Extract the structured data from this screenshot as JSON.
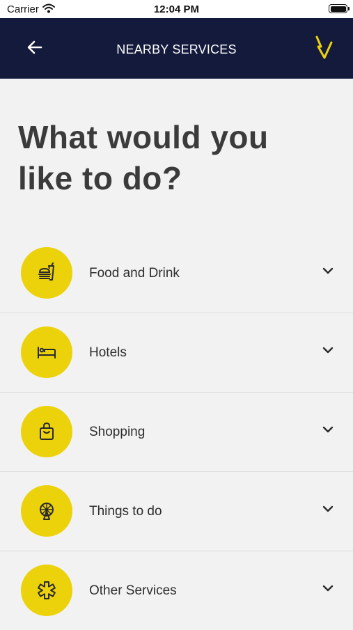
{
  "status": {
    "carrier": "Carrier",
    "time": "12:04 PM"
  },
  "nav": {
    "title": "NEARBY SERVICES"
  },
  "heading": "What would you like to do?",
  "categories": [
    {
      "label": "Food and Drink",
      "icon": "food-icon"
    },
    {
      "label": "Hotels",
      "icon": "bed-icon"
    },
    {
      "label": "Shopping",
      "icon": "bag-icon"
    },
    {
      "label": "Things to do",
      "icon": "ferris-wheel-icon"
    },
    {
      "label": "Other Services",
      "icon": "asterisk-icon"
    }
  ],
  "colors": {
    "navbar": "#141a3b",
    "accent": "#ecd20a",
    "background": "#f2f2f2"
  }
}
